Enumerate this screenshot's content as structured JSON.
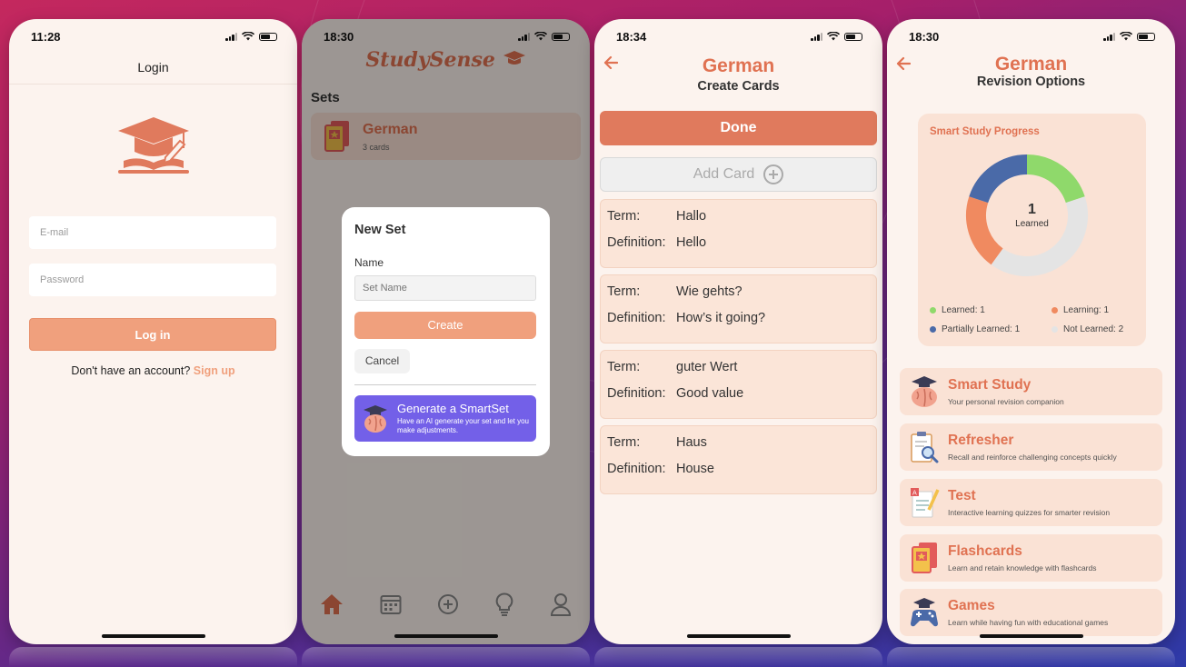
{
  "colors": {
    "accent": "#e07252",
    "button": "#f0a07d",
    "smartset": "#7360e8",
    "learned": "#8fd96b",
    "learning": "#f08a60",
    "partially": "#4a6aa8",
    "not_learned": "#e4e4e4"
  },
  "phone1": {
    "time": "11:28",
    "header": "Login",
    "logo_icon": "graduation-cap-book-icon",
    "email_placeholder": "E-mail",
    "password_placeholder": "Password",
    "login_button": "Log in",
    "signup_prompt": "Don't have an account?",
    "signup_link": "Sign up"
  },
  "phone2": {
    "time": "18:30",
    "logo_text": "StudySense",
    "sets_heading": "Sets",
    "set": {
      "title": "German",
      "subtitle": "3 cards"
    },
    "modal": {
      "title": "New Set",
      "name_label": "Name",
      "name_placeholder": "Set Name",
      "create_button": "Create",
      "cancel_button": "Cancel",
      "smartset_title": "Generate a SmartSet",
      "smartset_desc": "Have an AI generate your set and let you make adjustments."
    },
    "tabs": [
      "home-icon",
      "calendar-icon",
      "add-circle-icon",
      "lightbulb-icon",
      "profile-icon"
    ]
  },
  "phone3": {
    "time": "18:34",
    "title": "German",
    "subtitle": "Create Cards",
    "done_button": "Done",
    "add_card_button": "Add Card",
    "term_label": "Term:",
    "definition_label": "Definition:",
    "cards": [
      {
        "term": "Hallo",
        "definition": "Hello"
      },
      {
        "term": "Wie gehts?",
        "definition": "How’s it going?"
      },
      {
        "term": "guter Wert",
        "definition": "Good value"
      },
      {
        "term": "Haus",
        "definition": "House"
      }
    ]
  },
  "phone4": {
    "time": "18:30",
    "title": "German",
    "subtitle": "Revision Options",
    "progress": {
      "title": "Smart Study Progress",
      "center_value": "1",
      "center_label": "Learned",
      "legend": [
        {
          "label": "Learned: 1",
          "value": 1,
          "color": "#8fd96b"
        },
        {
          "label": "Learning: 1",
          "value": 1,
          "color": "#f08a60"
        },
        {
          "label": "Partially Learned: 1",
          "value": 1,
          "color": "#4a6aa8"
        },
        {
          "label": "Not Learned: 2",
          "value": 2,
          "color": "#e4e4e4"
        }
      ]
    },
    "options": [
      {
        "title": "Smart Study",
        "desc": "Your personal revision companion",
        "icon": "brain-cap-icon"
      },
      {
        "title": "Refresher",
        "desc": "Recall and reinforce challenging concepts quickly",
        "icon": "clipboard-search-icon"
      },
      {
        "title": "Test",
        "desc": "Interactive learning quizzes for smarter revision",
        "icon": "test-paper-icon"
      },
      {
        "title": "Flashcards",
        "desc": "Learn and retain knowledge with flashcards",
        "icon": "flashcards-icon"
      },
      {
        "title": "Games",
        "desc": "Learn while having fun with educational games",
        "icon": "gamepad-icon"
      }
    ]
  }
}
